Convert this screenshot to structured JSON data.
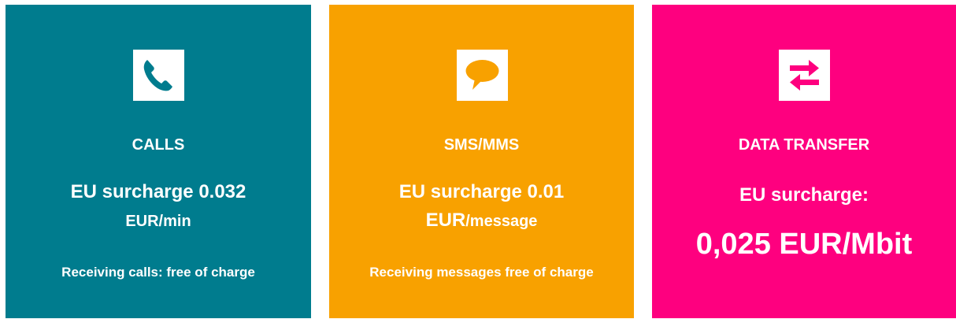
{
  "colors": {
    "calls": "#007c8e",
    "sms": "#f8a100",
    "data": "#fe007f"
  },
  "cards": {
    "calls": {
      "icon": "phone-icon",
      "title": "CALLS",
      "surcharge_line1": "EU surcharge 0.032",
      "surcharge_line2": "EUR/min",
      "note": "Receiving calls: free of charge"
    },
    "sms": {
      "icon": "speech-bubble-icon",
      "title": "SMS/MMS",
      "surcharge_line1": "EU surcharge 0.01",
      "surcharge_line2_currency": "EUR",
      "surcharge_line2_unit": "/message",
      "note": "Receiving messages free of charge"
    },
    "data": {
      "icon": "transfer-arrows-icon",
      "title": "DATA TRANSFER",
      "surcharge_label": "EU surcharge:",
      "price": "0,025 EUR/Mbit"
    }
  }
}
